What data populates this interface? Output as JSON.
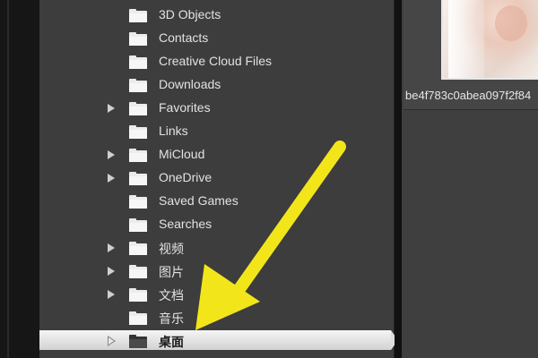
{
  "folder_tree": {
    "items": [
      {
        "label": "3D Objects",
        "expandable": false,
        "selected": false
      },
      {
        "label": "Contacts",
        "expandable": false,
        "selected": false
      },
      {
        "label": "Creative Cloud Files",
        "expandable": false,
        "selected": false
      },
      {
        "label": "Downloads",
        "expandable": false,
        "selected": false
      },
      {
        "label": "Favorites",
        "expandable": true,
        "selected": false
      },
      {
        "label": "Links",
        "expandable": false,
        "selected": false
      },
      {
        "label": "MiCloud",
        "expandable": true,
        "selected": false
      },
      {
        "label": "OneDrive",
        "expandable": true,
        "selected": false
      },
      {
        "label": "Saved Games",
        "expandable": false,
        "selected": false
      },
      {
        "label": "Searches",
        "expandable": false,
        "selected": false
      },
      {
        "label": "视频",
        "expandable": true,
        "selected": false
      },
      {
        "label": "图片",
        "expandable": true,
        "selected": false
      },
      {
        "label": "文档",
        "expandable": true,
        "selected": false
      },
      {
        "label": "音乐",
        "expandable": false,
        "selected": false
      },
      {
        "label": "桌面",
        "expandable": true,
        "selected": true
      }
    ],
    "icon": "folder-icon",
    "expand_icon": "expand-arrow-icon"
  },
  "thumbnail": {
    "filename": "be4f783c0abea097f2f84"
  },
  "annotation": {
    "icon": "yellow-pointer-arrow-icon",
    "color": "#f2e61a"
  },
  "colors": {
    "panel_bg": "#3d3d3d",
    "selection": "#dedede",
    "text": "#e2e2e2",
    "selected_text": "#1a1a1a"
  }
}
